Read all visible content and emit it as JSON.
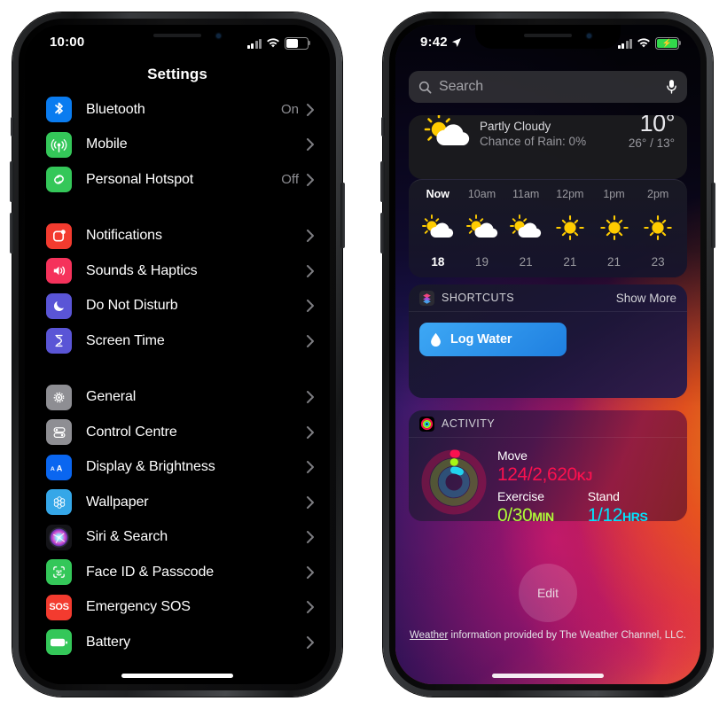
{
  "left_phone": {
    "status_bar": {
      "time": "10:00",
      "cellular_icon": "signal-bars-icon",
      "wifi_icon": "wifi-icon",
      "battery_icon": "battery-icon",
      "battery_charging": false,
      "battery_level": 62
    },
    "nav_title": "Settings",
    "groups": [
      {
        "rows": [
          {
            "icon": "bluetooth-icon",
            "label": "Bluetooth",
            "value": "On",
            "color": "#0a7cf0"
          },
          {
            "icon": "mobile-data-icon",
            "label": "Mobile",
            "value": "",
            "color": "#34c759"
          },
          {
            "icon": "personal-hotspot-icon",
            "label": "Personal Hotspot",
            "value": "Off",
            "color": "#34c759"
          }
        ]
      },
      {
        "rows": [
          {
            "icon": "notifications-icon",
            "label": "Notifications",
            "value": "",
            "color": "#f33b2f"
          },
          {
            "icon": "sounds-haptics-icon",
            "label": "Sounds & Haptics",
            "value": "",
            "color": "#f5325b"
          },
          {
            "icon": "do-not-disturb-icon",
            "label": "Do Not Disturb",
            "value": "",
            "color": "#5a55d6"
          },
          {
            "icon": "screen-time-icon",
            "label": "Screen Time",
            "value": "",
            "color": "#5a55d6"
          }
        ]
      },
      {
        "rows": [
          {
            "icon": "general-settings-icon",
            "label": "General",
            "value": "",
            "color": "#8e8e93"
          },
          {
            "icon": "control-centre-icon",
            "label": "Control Centre",
            "value": "",
            "color": "#8e8e93"
          },
          {
            "icon": "display-brightness-icon",
            "label": "Display & Brightness",
            "value": "",
            "color": "#0a66f0"
          },
          {
            "icon": "wallpaper-icon",
            "label": "Wallpaper",
            "value": "",
            "color": "#35a7e8"
          },
          {
            "icon": "siri-search-icon",
            "label": "Siri & Search",
            "value": "",
            "color": "#1c1c1e"
          },
          {
            "icon": "face-id-passcode-icon",
            "label": "Face ID & Passcode",
            "value": "",
            "color": "#34c759"
          },
          {
            "icon": "emergency-sos-icon",
            "label": "Emergency SOS",
            "value": "",
            "color": "#f33b2f"
          },
          {
            "icon": "battery-settings-icon",
            "label": "Battery",
            "value": "",
            "color": "#34c759"
          }
        ]
      }
    ],
    "chevron": "›"
  },
  "right_phone": {
    "status_bar": {
      "time": "9:42",
      "location_icon": "location-arrow-icon",
      "cellular_icon": "signal-bars-icon",
      "wifi_icon": "wifi-icon",
      "battery_icon": "battery-charging-icon",
      "battery_charging": true
    },
    "search": {
      "placeholder": "Search",
      "search_icon": "search-icon",
      "mic_icon": "microphone-icon"
    },
    "weather": {
      "icon": "sun-behind-cloud-icon",
      "condition": "Partly Cloudy",
      "rain": "Chance of Rain: 0%",
      "current_temp": "10°",
      "high_low": "26° / 13°",
      "hourly": [
        {
          "time": "Now",
          "icon": "sun-behind-cloud-icon",
          "temp": "18",
          "current": true
        },
        {
          "time": "10am",
          "icon": "sun-behind-cloud-icon",
          "temp": "19",
          "current": false
        },
        {
          "time": "11am",
          "icon": "sun-behind-cloud-icon",
          "temp": "21",
          "current": false
        },
        {
          "time": "12pm",
          "icon": "sun-icon",
          "temp": "21",
          "current": false
        },
        {
          "time": "1pm",
          "icon": "sun-icon",
          "temp": "21",
          "current": false
        },
        {
          "time": "2pm",
          "icon": "sun-icon",
          "temp": "23",
          "current": false
        }
      ]
    },
    "shortcuts": {
      "app_icon": "shortcuts-icon",
      "title": "SHORTCUTS",
      "show_more": "Show More",
      "buttons": [
        {
          "label": "Log Water",
          "icon": "water-drop-icon",
          "color": "#2f96ef"
        }
      ]
    },
    "activity": {
      "app_icon": "activity-rings-icon",
      "title": "ACTIVITY",
      "move": {
        "label": "Move",
        "value": "124/2,620",
        "unit": "KJ",
        "color": "#fa114f"
      },
      "exercise": {
        "label": "Exercise",
        "value": "0/30",
        "unit": "MIN",
        "color": "#b0fc38"
      },
      "stand": {
        "label": "Stand",
        "value": "1/12",
        "unit": "HRS",
        "color": "#00e5ff"
      }
    },
    "edit_button": "Edit",
    "footer": {
      "link": "Weather",
      "text": " information provided by The Weather Channel, LLC."
    }
  }
}
